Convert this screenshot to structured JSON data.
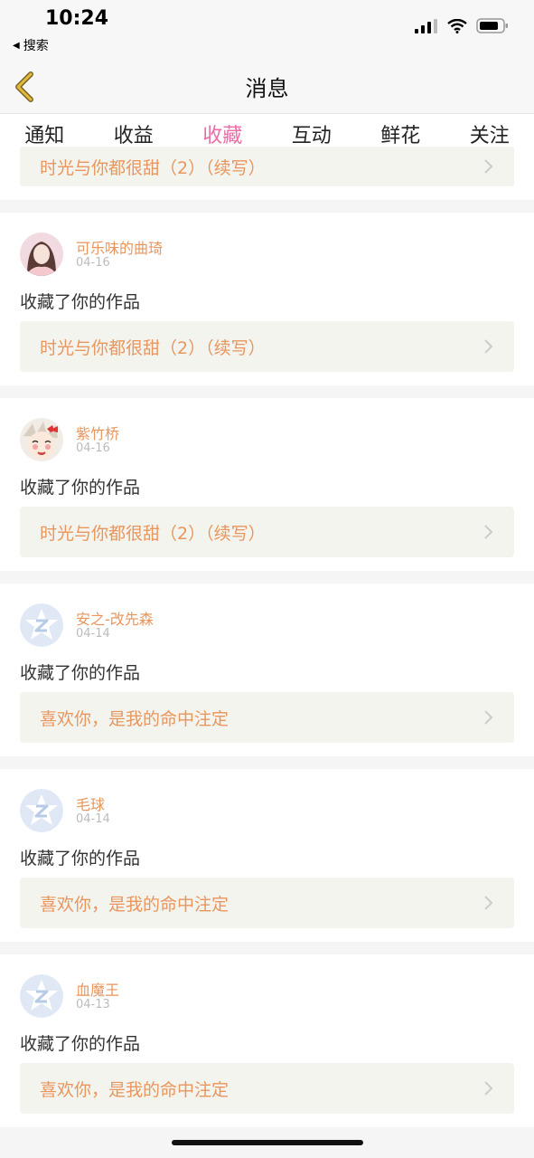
{
  "status_bar": {
    "time": "10:24",
    "back_app": "搜索"
  },
  "nav": {
    "title": "消息"
  },
  "tabs": [
    {
      "label": "通知",
      "active": false
    },
    {
      "label": "收益",
      "active": false
    },
    {
      "label": "收藏",
      "active": true
    },
    {
      "label": "互动",
      "active": false
    },
    {
      "label": "鲜花",
      "active": false
    },
    {
      "label": "关注",
      "active": false
    }
  ],
  "partial_item": {
    "work_title": "时光与你都很甜（2）（续写）"
  },
  "items": [
    {
      "username": "可乐味的曲琦",
      "date": "04-16",
      "action": "收藏了你的作品",
      "work_title": "时光与你都很甜（2）（续写）",
      "avatar": "photo-girl"
    },
    {
      "username": "紫竹桥",
      "date": "04-16",
      "action": "收藏了你的作品",
      "work_title": "时光与你都很甜（2）（续写）",
      "avatar": "cartoon-character"
    },
    {
      "username": "安之-改先森",
      "date": "04-14",
      "action": "收藏了你的作品",
      "work_title": "喜欢你，是我的命中注定",
      "avatar": "default-z-star"
    },
    {
      "username": "毛球",
      "date": "04-14",
      "action": "收藏了你的作品",
      "work_title": "喜欢你，是我的命中注定",
      "avatar": "default-z-star"
    },
    {
      "username": "血魔王",
      "date": "04-13",
      "action": "收藏了你的作品",
      "work_title": "喜欢你，是我的命中注定",
      "avatar": "default-z-star"
    }
  ],
  "colors": {
    "accent_pink": "#e86fa6",
    "accent_orange": "#e8965d",
    "work_bg": "#f4f4ee",
    "back_arrow": "#e6b93a"
  }
}
